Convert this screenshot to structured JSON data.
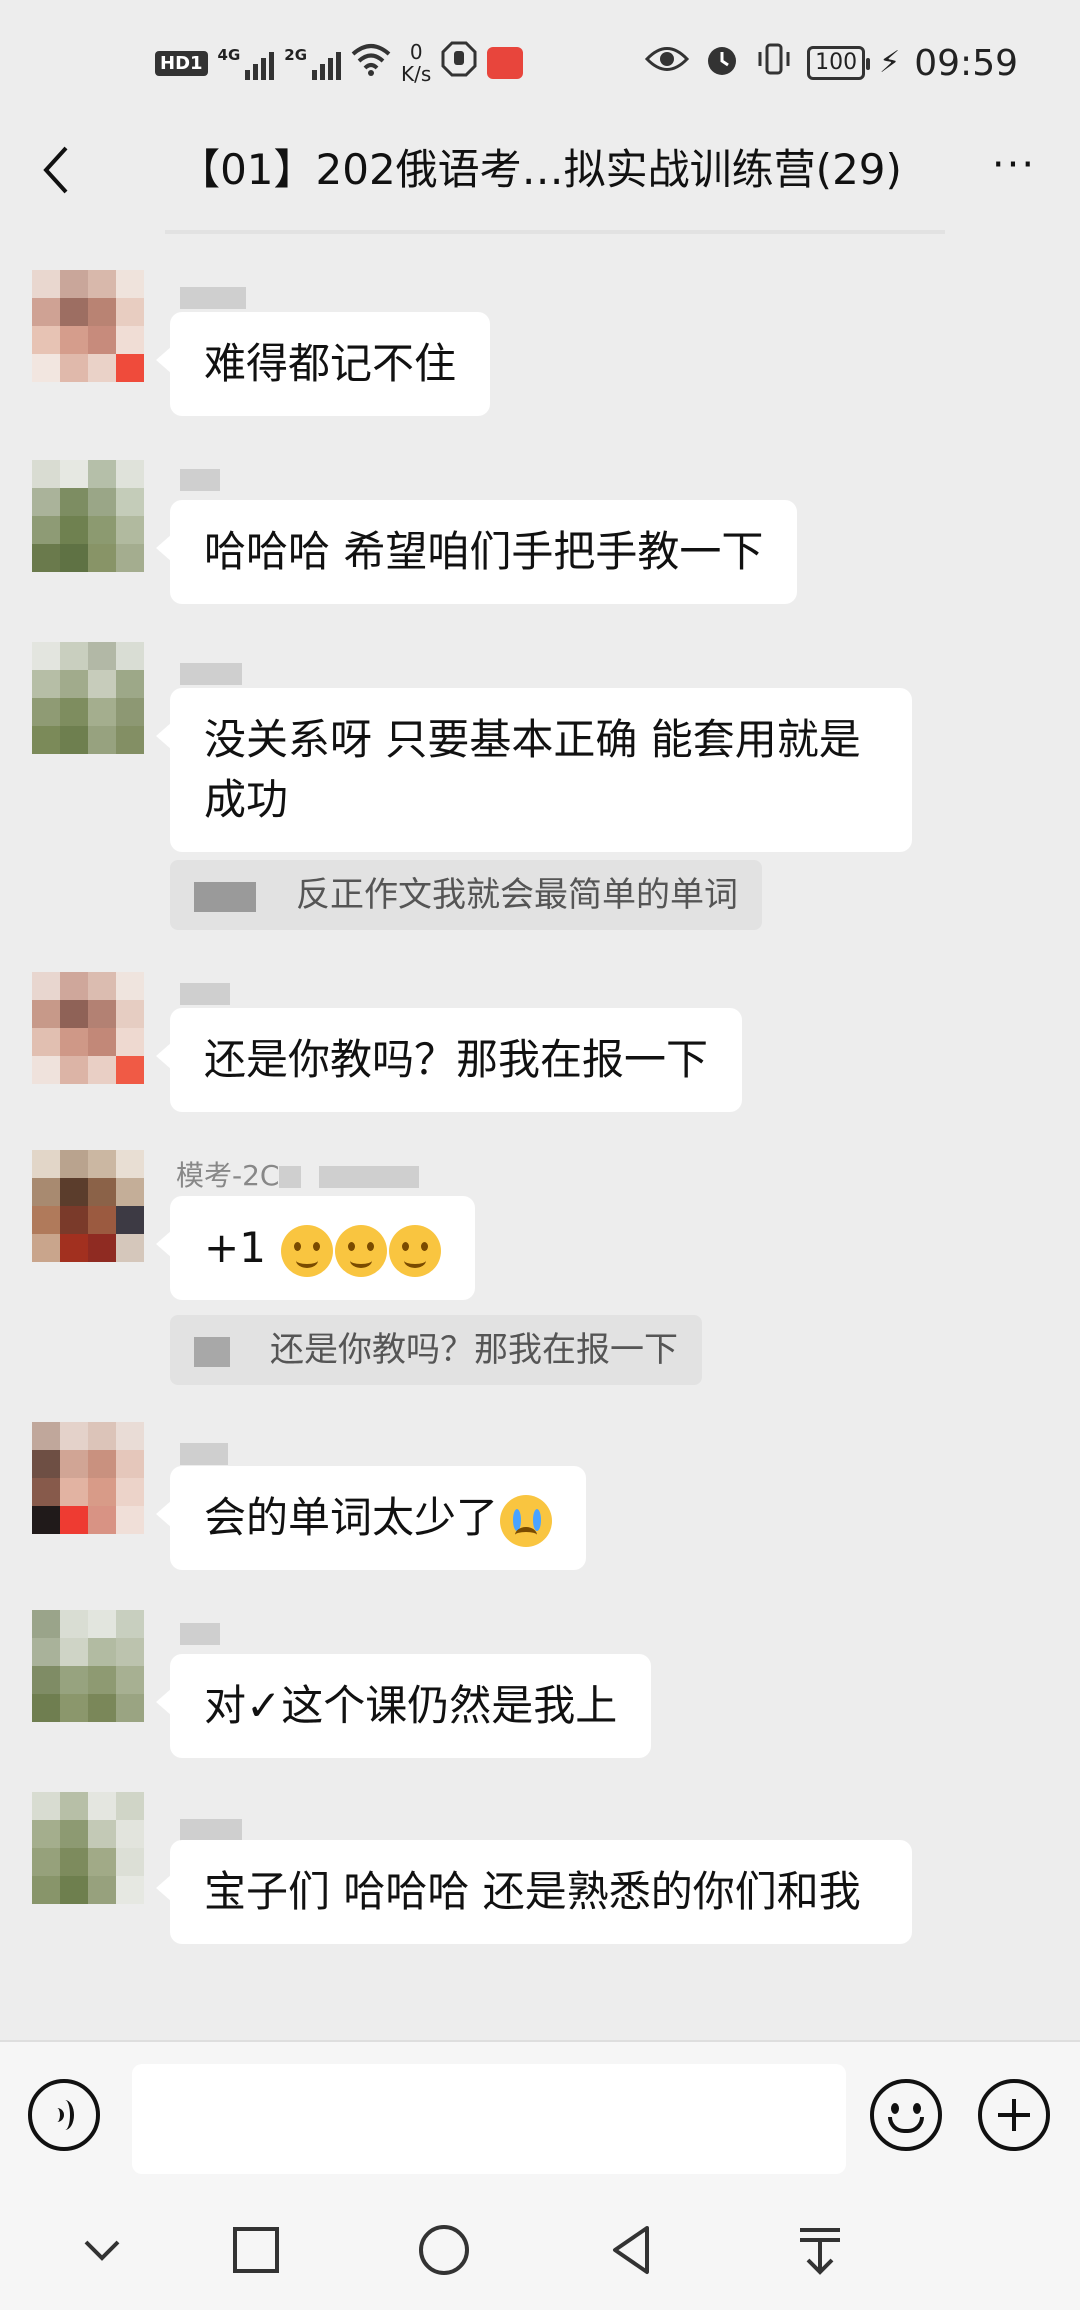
{
  "status_bar": {
    "hd": "HD",
    "hd_sub": "1",
    "net1": "4G",
    "net2": "2G",
    "speed_value": "0",
    "speed_unit": "K/s",
    "battery": "100",
    "time": "09:59"
  },
  "header": {
    "title": "【01】202俄语考…拟实战训练营(29)",
    "more_label": "···"
  },
  "messages": [
    {
      "text": "难得都记不住"
    },
    {
      "text": "哈哈哈 希望咱们手把手教一下"
    },
    {
      "text": "没关系呀 只要基本正确  能套用就是成功",
      "quote": "反正作文我就会最简单的单词"
    },
    {
      "text": "还是你教吗？那我在报一下"
    },
    {
      "name": "模考-2C",
      "text": "+1",
      "emoji_count": 3,
      "quote": "还是你教吗？那我在报一下"
    },
    {
      "text": "会的单词太少了",
      "emoji": "crying-face"
    },
    {
      "text": "对✓这个课仍然是我上"
    },
    {
      "text": "宝子们 哈哈哈 还是熟悉的你们和我"
    }
  ],
  "input": {
    "value": "",
    "placeholder": ""
  },
  "icons": {
    "back": "chevron-left-icon",
    "more": "more-icon",
    "voice": "voice-icon",
    "emoji": "emoji-icon",
    "plus": "plus-icon",
    "nav_down": "chevron-down-icon",
    "nav_recents": "square-icon",
    "nav_home": "circle-icon",
    "nav_back": "triangle-back-icon",
    "nav_pull": "pull-down-icon"
  },
  "colors": {
    "background": "#ededed",
    "bubble": "#ffffff",
    "quote": "#e2e2e2"
  }
}
